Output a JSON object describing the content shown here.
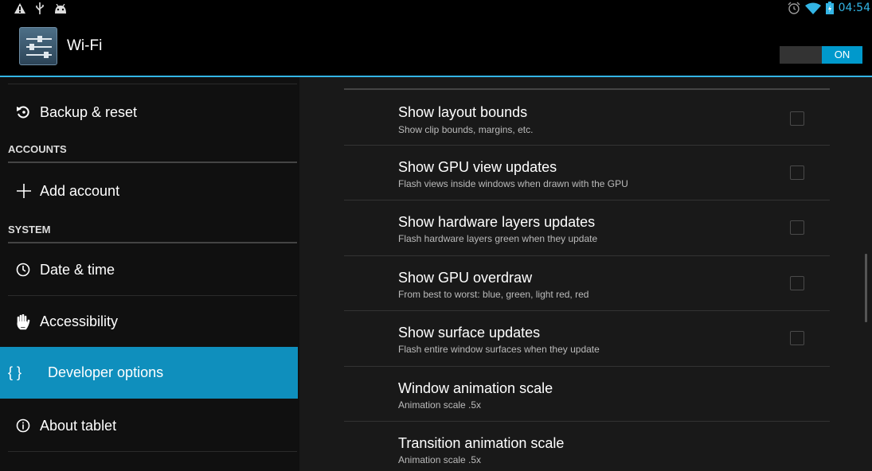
{
  "status_bar": {
    "left_icons": [
      "warning-icon",
      "usb-icon",
      "android-debug-icon"
    ],
    "right_icons": [
      "alarm-icon",
      "wifi-signal-icon",
      "battery-charging-icon"
    ],
    "time": "04:54"
  },
  "action_bar": {
    "title": "Wi-Fi",
    "toggle_label": "ON",
    "accent_color": "#33b5e5"
  },
  "sidebar": {
    "items": [
      {
        "label": "Backup & reset",
        "icon": "backup-reset-icon"
      },
      {
        "category": "ACCOUNTS"
      },
      {
        "label": "Add account",
        "icon": "plus-icon"
      },
      {
        "category": "SYSTEM"
      },
      {
        "label": "Date & time",
        "icon": "clock-icon"
      },
      {
        "label": "Accessibility",
        "icon": "hand-icon"
      },
      {
        "label": "Developer options",
        "icon": "braces-icon",
        "selected": true
      },
      {
        "label": "About tablet",
        "icon": "info-icon"
      }
    ],
    "selected_color": "#0f8fbd"
  },
  "settings": [
    {
      "title": "Show layout bounds",
      "summary": "Show clip bounds, margins, etc.",
      "checkbox": true,
      "checked": false
    },
    {
      "title": "Show GPU view updates",
      "summary": "Flash views inside windows when drawn with the GPU",
      "checkbox": true,
      "checked": false
    },
    {
      "title": "Show hardware layers updates",
      "summary": "Flash hardware layers green when they update",
      "checkbox": true,
      "checked": false
    },
    {
      "title": "Show GPU overdraw",
      "summary": "From best to worst: blue, green, light red, red",
      "checkbox": true,
      "checked": false
    },
    {
      "title": "Show surface updates",
      "summary": "Flash entire window surfaces when they update",
      "checkbox": true,
      "checked": false
    },
    {
      "title": "Window animation scale",
      "summary": "Animation scale .5x",
      "checkbox": false
    },
    {
      "title": "Transition animation scale",
      "summary": "Animation scale .5x",
      "checkbox": false
    }
  ]
}
